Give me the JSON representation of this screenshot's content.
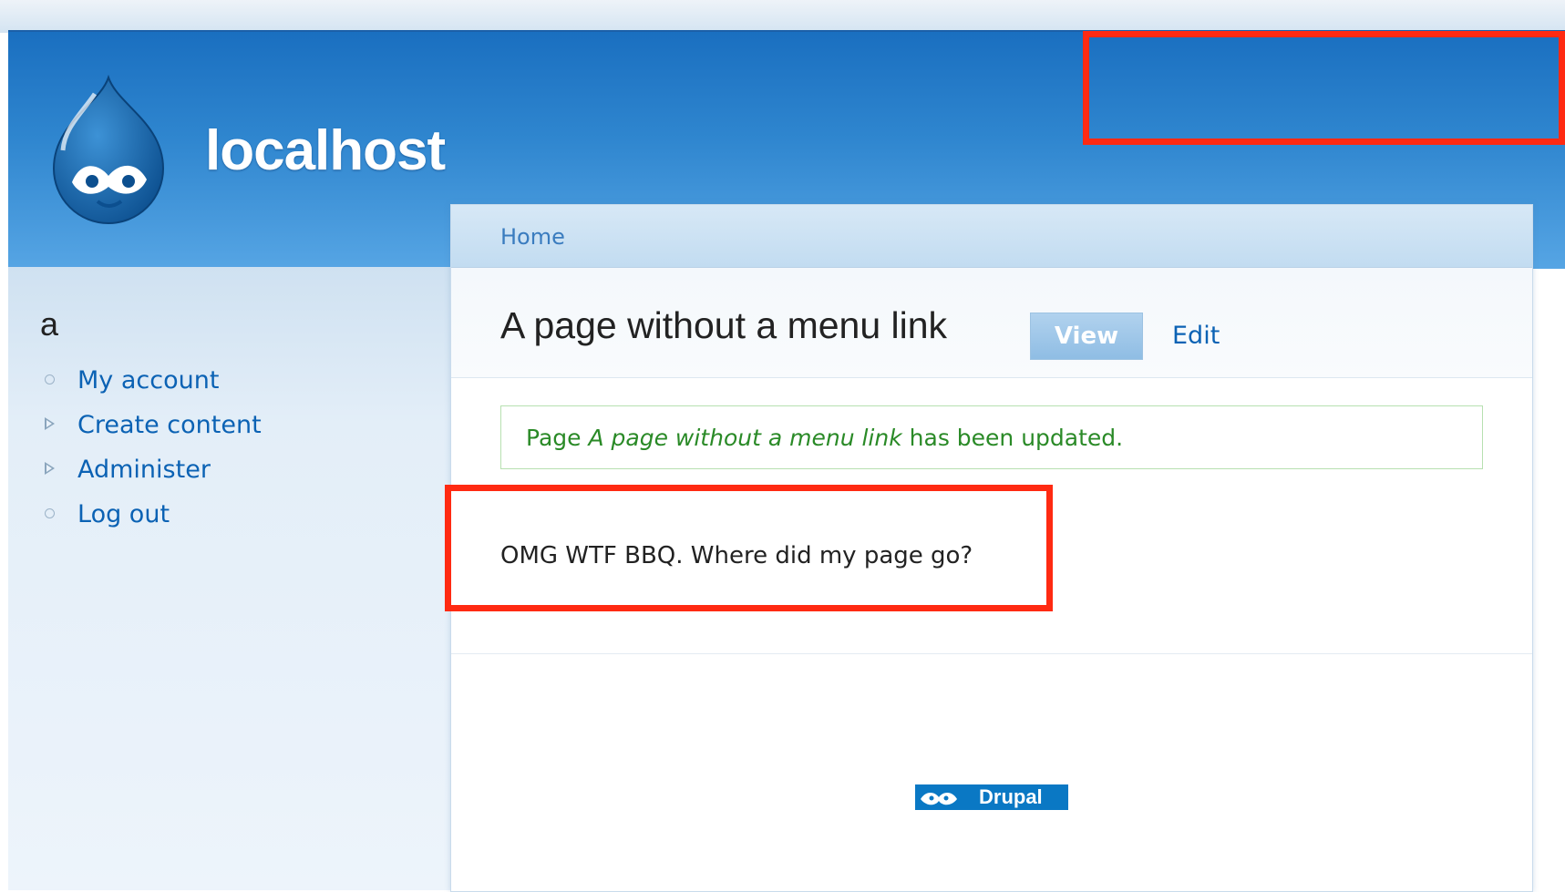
{
  "site": {
    "name": "localhost"
  },
  "sidebar": {
    "user_heading": "a",
    "items": [
      {
        "label": "My account",
        "bullet": "circle"
      },
      {
        "label": "Create content",
        "bullet": "triangle"
      },
      {
        "label": "Administer",
        "bullet": "triangle"
      },
      {
        "label": "Log out",
        "bullet": "circle"
      }
    ]
  },
  "breadcrumb": {
    "home_label": "Home"
  },
  "page": {
    "title": "A page without a menu link",
    "tabs": {
      "view_label": "View",
      "edit_label": "Edit"
    },
    "status": {
      "prefix": "Page",
      "node_title": "A page without a menu link",
      "suffix": "has been updated."
    },
    "body": "OMG WTF BBQ. Where did my page go?"
  },
  "footer": {
    "badge_label": "Drupal"
  },
  "colors": {
    "header_blue": "#2f86cf",
    "link_blue": "#0b62b4",
    "status_green": "#2a8a27",
    "highlight_red": "#ff2a12"
  }
}
